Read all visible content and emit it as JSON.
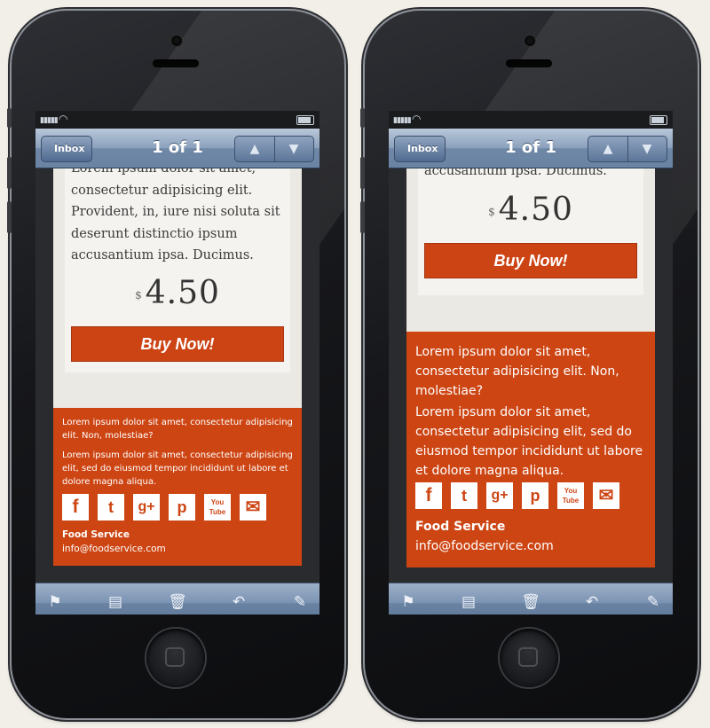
{
  "status": {
    "signal": "▮▮▮▮▮"
  },
  "nav": {
    "back_label": "Inbox",
    "title": "1 of 1",
    "up": "▲",
    "down": "▼"
  },
  "email": {
    "body": "Lorem ipsum dolor sit amet, consectetur adipisicing elit. Provident, in, iure nisi soluta sit deserunt distinctio ipsum accusantium ipsa. Ducimus.",
    "body_tail": "accusantium ipsa. Ducimus.",
    "currency": "$",
    "price": "4.50",
    "buy_label": "Buy Now!"
  },
  "footer": {
    "p1": "Lorem ipsum dolor sit amet, consectetur adipisicing elit. Non, molestiae?",
    "p2": "Lorem ipsum dolor sit amet, consectetur adipisicing elit, sed do eiusmod tempor incididunt ut labore et dolore magna aliqua.",
    "company": "Food Service",
    "email": "info@foodservice.com",
    "social": [
      {
        "icon": "facebook-icon",
        "glyph": "f"
      },
      {
        "icon": "twitter-icon",
        "glyph": "t"
      },
      {
        "icon": "google-plus-icon",
        "glyph": "g+"
      },
      {
        "icon": "pinterest-icon",
        "glyph": "p"
      },
      {
        "icon": "youtube-icon",
        "glyph": "You Tube"
      },
      {
        "icon": "mail-icon",
        "glyph": "✉"
      }
    ]
  },
  "toolbar": {
    "flag": "⚑",
    "move": "▤",
    "trash": "🗑",
    "reply": "↶",
    "compose": "✎"
  },
  "colors": {
    "accent": "#cc4414",
    "footer_bg": "#cd4513",
    "nav_bar": "#7b93b3"
  }
}
